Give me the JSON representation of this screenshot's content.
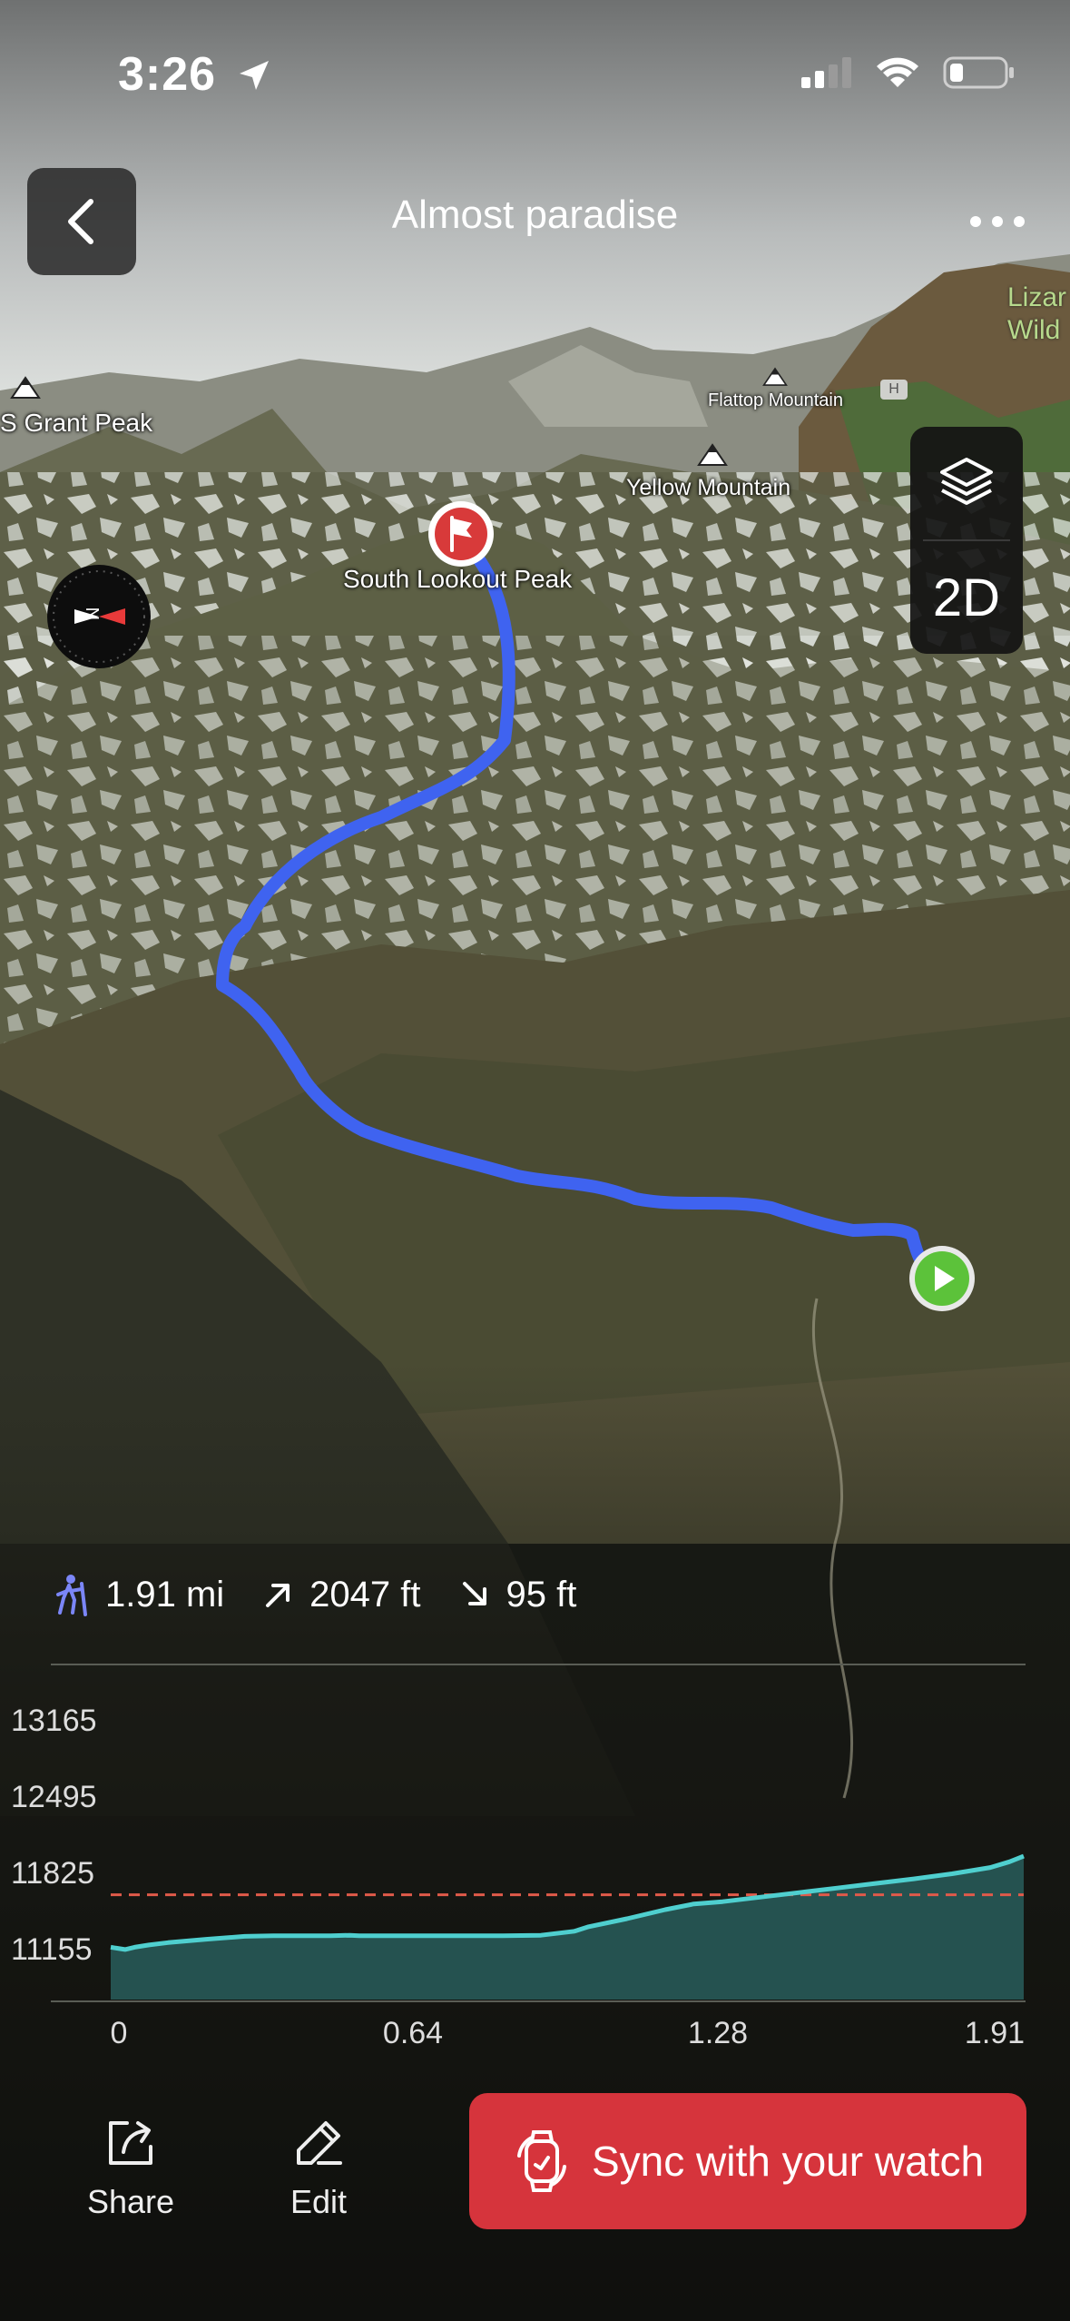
{
  "status_bar": {
    "time": "3:26",
    "icons": [
      "location-arrow-icon",
      "cellular-signal-icon",
      "wifi-icon",
      "battery-icon"
    ]
  },
  "header": {
    "title": "Almost paradise",
    "back_icon": "chevron-left-icon",
    "more_icon": "more-dots-icon"
  },
  "map_controls": {
    "layers_icon": "layers-icon",
    "mode_label": "2D"
  },
  "map": {
    "labels": {
      "grant_peak": "S Grant Peak",
      "flattop": "Flattop Mountain",
      "yellow": "Yellow Mountain",
      "south_lookout": "South Lookout Peak",
      "wilderness_line1": "Lizar",
      "wilderness_line2": "Wild"
    },
    "route_color": "#3f63f0",
    "start_marker_color": "#5cc23a",
    "end_marker_color": "#d83a3a"
  },
  "stats": {
    "distance": "1.91 mi",
    "ascent": "2047 ft",
    "descent": "95 ft"
  },
  "chart_data": {
    "type": "area",
    "x": [
      0,
      0.03,
      0.05,
      0.08,
      0.12,
      0.2,
      0.28,
      0.34,
      0.4,
      0.46,
      0.5,
      0.52,
      0.56,
      0.6,
      0.66,
      0.74,
      0.82,
      0.9,
      0.97,
      1.0,
      1.08,
      1.16,
      1.22,
      1.28,
      1.36,
      1.44,
      1.52,
      1.6,
      1.68,
      1.76,
      1.84,
      1.88,
      1.91
    ],
    "values": [
      11200,
      11180,
      11200,
      11220,
      11240,
      11270,
      11295,
      11300,
      11300,
      11300,
      11305,
      11300,
      11300,
      11300,
      11300,
      11300,
      11300,
      11305,
      11340,
      11380,
      11450,
      11530,
      11580,
      11600,
      11640,
      11680,
      11720,
      11760,
      11800,
      11845,
      11900,
      11950,
      12000
    ],
    "series_color": "#4fcfcf",
    "yticks": [
      "13165",
      "12495",
      "11825",
      "11155"
    ],
    "xticks": [
      "0",
      "0.64",
      "1.28",
      "1.91"
    ],
    "reference_line": 11660,
    "reference_line_color": "#e05a4a",
    "ylim": [
      11155,
      13165
    ],
    "xlim": [
      0,
      1.91
    ],
    "grid": false
  },
  "bottom_bar": {
    "share_label": "Share",
    "share_icon": "share-icon",
    "edit_label": "Edit",
    "edit_icon": "pencil-icon",
    "sync_label": "Sync with your watch",
    "sync_icon": "watch-sync-icon",
    "sync_color": "#d6343c"
  }
}
